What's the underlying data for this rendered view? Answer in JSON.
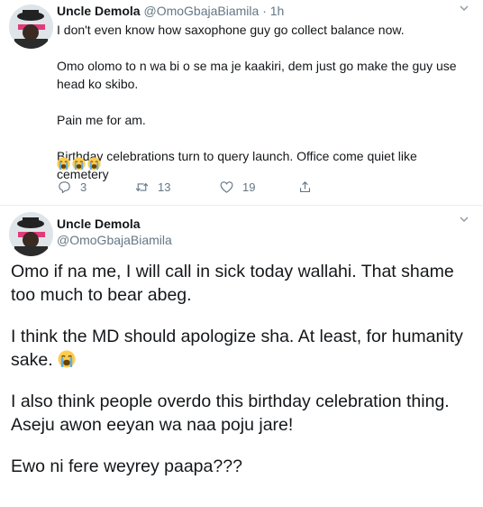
{
  "tweet1": {
    "name": "Uncle Demola",
    "handle": "@OmoGbajaBiamila",
    "separator": "·",
    "time": "1h",
    "paragraphs": [
      "I don't even know how saxophone guy go collect balance now.",
      "Omo olomo to n wa bi o se ma je kaakiri, dem just go make the guy use head ko skibo.",
      "Pain me for am.",
      "Birthday celebrations turn to query launch. Office come quiet like cemetery"
    ],
    "emojis": [
      "loudly-crying-face",
      "loudly-crying-face",
      "loudly-crying-face"
    ],
    "actions": {
      "replies": "3",
      "retweets": "13",
      "likes": "19"
    }
  },
  "tweet2": {
    "name": "Uncle Demola",
    "handle": "@OmoGbajaBiamila",
    "p1": "Omo if na me, I will call in sick today wallahi. That shame too much to bear abeg.",
    "p2": "I think the MD should apologize sha. At least, for humanity sake.",
    "p2_emoji": "loudly-crying-face",
    "p3": "I also think people overdo this birthday celebration thing. Aseju awon eeyan wa naa poju jare!",
    "p4": "Ewo ni fere weyrey paapa???"
  },
  "colors": {
    "text": "#14171a",
    "secondary": "#657786",
    "divider": "#e6ecf0"
  }
}
